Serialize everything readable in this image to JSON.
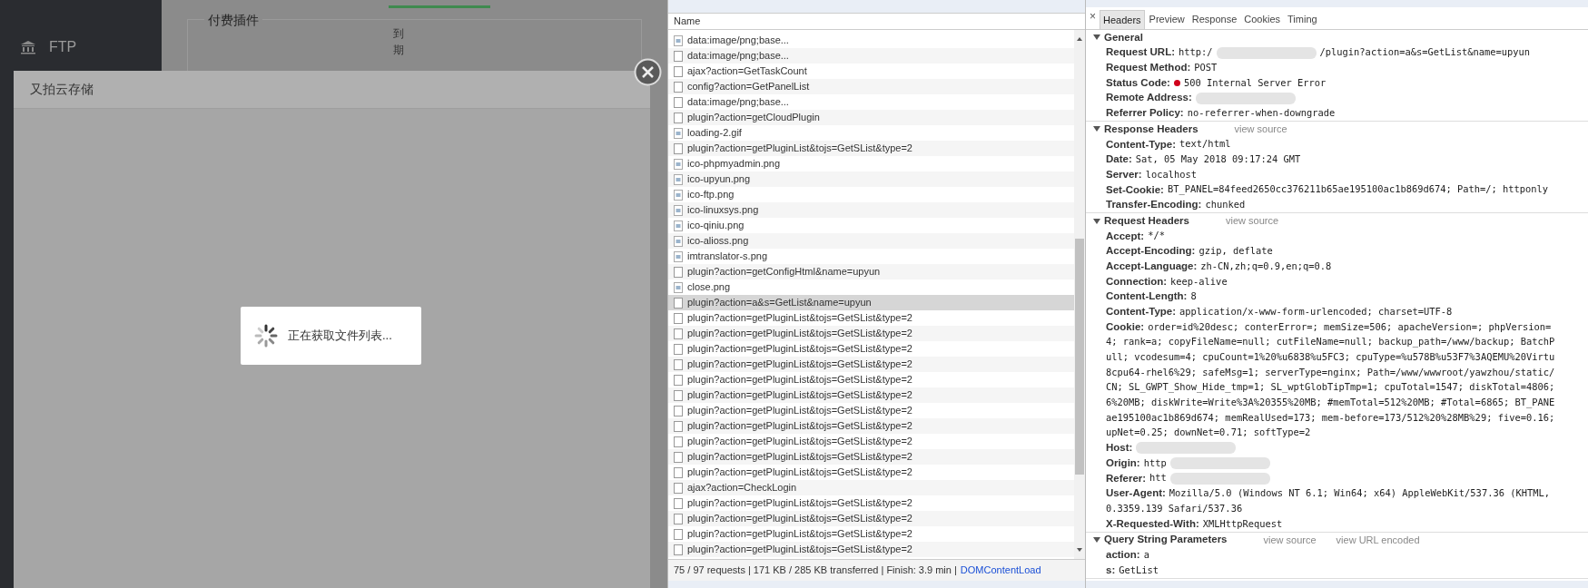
{
  "sidebar": {
    "items": [
      {
        "label": "FTP"
      }
    ]
  },
  "page": {
    "section_title": "付费插件",
    "column_header": "到期"
  },
  "modal": {
    "title": "又拍云存储",
    "loading_text": "正在获取文件列表..."
  },
  "network": {
    "column": "Name",
    "rows": [
      {
        "name": "data:image/png;base...",
        "kind": "image",
        "selected": false
      },
      {
        "name": "data:image/png;base...",
        "kind": "doc",
        "selected": false
      },
      {
        "name": "ajax?action=GetTaskCount",
        "kind": "doc",
        "selected": false
      },
      {
        "name": "config?action=GetPanelList",
        "kind": "doc",
        "selected": false
      },
      {
        "name": "data:image/png;base...",
        "kind": "doc",
        "selected": false
      },
      {
        "name": "plugin?action=getCloudPlugin",
        "kind": "doc",
        "selected": false
      },
      {
        "name": "loading-2.gif",
        "kind": "image",
        "selected": false
      },
      {
        "name": "plugin?action=getPluginList&tojs=GetSList&type=2",
        "kind": "doc",
        "selected": false
      },
      {
        "name": "ico-phpmyadmin.png",
        "kind": "image",
        "selected": false
      },
      {
        "name": "ico-upyun.png",
        "kind": "image",
        "selected": false
      },
      {
        "name": "ico-ftp.png",
        "kind": "image",
        "selected": false
      },
      {
        "name": "ico-linuxsys.png",
        "kind": "image",
        "selected": false
      },
      {
        "name": "ico-qiniu.png",
        "kind": "image",
        "selected": false
      },
      {
        "name": "ico-alioss.png",
        "kind": "image",
        "selected": false
      },
      {
        "name": "imtranslator-s.png",
        "kind": "image",
        "selected": false
      },
      {
        "name": "plugin?action=getConfigHtml&name=upyun",
        "kind": "doc",
        "selected": false
      },
      {
        "name": "close.png",
        "kind": "image",
        "selected": false
      },
      {
        "name": "plugin?action=a&s=GetList&name=upyun",
        "kind": "doc",
        "selected": true
      },
      {
        "name": "plugin?action=getPluginList&tojs=GetSList&type=2",
        "kind": "doc",
        "selected": false
      },
      {
        "name": "plugin?action=getPluginList&tojs=GetSList&type=2",
        "kind": "doc",
        "selected": false
      },
      {
        "name": "plugin?action=getPluginList&tojs=GetSList&type=2",
        "kind": "doc",
        "selected": false
      },
      {
        "name": "plugin?action=getPluginList&tojs=GetSList&type=2",
        "kind": "doc",
        "selected": false
      },
      {
        "name": "plugin?action=getPluginList&tojs=GetSList&type=2",
        "kind": "doc",
        "selected": false
      },
      {
        "name": "plugin?action=getPluginList&tojs=GetSList&type=2",
        "kind": "doc",
        "selected": false
      },
      {
        "name": "plugin?action=getPluginList&tojs=GetSList&type=2",
        "kind": "doc",
        "selected": false
      },
      {
        "name": "plugin?action=getPluginList&tojs=GetSList&type=2",
        "kind": "doc",
        "selected": false
      },
      {
        "name": "plugin?action=getPluginList&tojs=GetSList&type=2",
        "kind": "doc",
        "selected": false
      },
      {
        "name": "plugin?action=getPluginList&tojs=GetSList&type=2",
        "kind": "doc",
        "selected": false
      },
      {
        "name": "plugin?action=getPluginList&tojs=GetSList&type=2",
        "kind": "doc",
        "selected": false
      },
      {
        "name": "ajax?action=CheckLogin",
        "kind": "doc",
        "selected": false
      },
      {
        "name": "plugin?action=getPluginList&tojs=GetSList&type=2",
        "kind": "doc",
        "selected": false
      },
      {
        "name": "plugin?action=getPluginList&tojs=GetSList&type=2",
        "kind": "doc",
        "selected": false
      },
      {
        "name": "plugin?action=getPluginList&tojs=GetSList&type=2",
        "kind": "doc",
        "selected": false
      },
      {
        "name": "plugin?action=getPluginList&tojs=GetSList&type=2",
        "kind": "doc",
        "selected": false
      }
    ],
    "status": {
      "summary": "75 / 97 requests | 171 KB / 285 KB transferred | Finish: 3.9 min |",
      "link": "DOMContentLoad"
    }
  },
  "details": {
    "close_glyph": "×",
    "tabs": [
      {
        "label": "Headers",
        "selected": true
      },
      {
        "label": "Preview",
        "selected": false
      },
      {
        "label": "Response",
        "selected": false
      },
      {
        "label": "Cookies",
        "selected": false
      },
      {
        "label": "Timing",
        "selected": false
      }
    ],
    "sections": [
      {
        "title": "General",
        "expanded": true,
        "headers": [
          {
            "name": "Request URL:",
            "value": "http:/",
            "redacted": true,
            "value_after": "/plugin?action=a&s=GetList&name=upyun"
          },
          {
            "name": "Request Method:",
            "value": "POST"
          },
          {
            "name": "Status Code:",
            "value": "500 Internal Server Error",
            "color": "#d0021b"
          },
          {
            "name": "Remote Address:",
            "redacted": true
          },
          {
            "name": "Referrer Policy:",
            "value": "no-referrer-when-downgrade"
          }
        ]
      },
      {
        "title": "Response Headers",
        "expanded": true,
        "links": [
          "view source"
        ],
        "headers": [
          {
            "name": "Content-Type:",
            "value": "text/html"
          },
          {
            "name": "Date:",
            "value": "Sat, 05 May 2018 09:17:24 GMT"
          },
          {
            "name": "Server:",
            "value": "localhost"
          },
          {
            "name": "Set-Cookie:",
            "value": "BT_PANEL=84feed2650cc376211b65ae195100ac1b869d674; Path=/; httponly"
          },
          {
            "name": "Transfer-Encoding:",
            "value": "chunked"
          }
        ]
      },
      {
        "title": "Request Headers",
        "expanded": true,
        "links": [
          "view source"
        ],
        "headers": [
          {
            "name": "Accept:",
            "value": "*/*"
          },
          {
            "name": "Accept-Encoding:",
            "value": "gzip, deflate"
          },
          {
            "name": "Accept-Language:",
            "value": "zh-CN,zh;q=0.9,en;q=0.8"
          },
          {
            "name": "Connection:",
            "value": "keep-alive"
          },
          {
            "name": "Content-Length:",
            "value": "8"
          },
          {
            "name": "Content-Type:",
            "value": "application/x-www-form-urlencoded; charset=UTF-8"
          },
          {
            "name": "Cookie:",
            "value": "order=id%20desc; conterError=; memSize=506; apacheVersion=; phpVersion=",
            "more_lines": [
              "4; rank=a; copyFileName=null; cutFileName=null; backup_path=/www/backup; BatchP",
              "ull; vcodesum=4; cpuCount=1%20%u6838%u5FC3; cpuType=%u578B%u53F7%3AQEMU%20Virtu",
              "8cpu64-rhel6%29; safeMsg=1; serverType=nginx; Path=/www/wwwroot/yawzhou/static/",
              "CN; SL_GWPT_Show_Hide_tmp=1; SL_wptGlobTipTmp=1; cpuTotal=1547; diskTotal=4806;",
              "6%20MB; diskWrite=Write%3A%20355%20MB; #memTotal=512%20MB; #Total=6865; BT_PANE",
              "ae195100ac1b869d674; memRealUsed=173; mem-before=173/512%20%28MB%29; five=0.16;",
              "upNet=0.25; downNet=0.71; softType=2"
            ]
          },
          {
            "name": "Host:",
            "redacted": true
          },
          {
            "name": "Origin:",
            "value": "http",
            "redacted": true
          },
          {
            "name": "Referer:",
            "value": "htt",
            "redacted": true
          },
          {
            "name": "User-Agent:",
            "value": "Mozilla/5.0 (Windows NT 6.1; Win64; x64) AppleWebKit/537.36 (KHTML,",
            "more_lines": [
              "0.3359.139 Safari/537.36"
            ]
          },
          {
            "name": "X-Requested-With:",
            "value": "XMLHttpRequest"
          }
        ]
      },
      {
        "title": "Query String Parameters",
        "expanded": true,
        "links": [
          "view source",
          "view URL encoded"
        ],
        "headers": [
          {
            "name": "action:",
            "value": "a"
          },
          {
            "name": "s:",
            "value": "GetList"
          }
        ]
      }
    ]
  }
}
